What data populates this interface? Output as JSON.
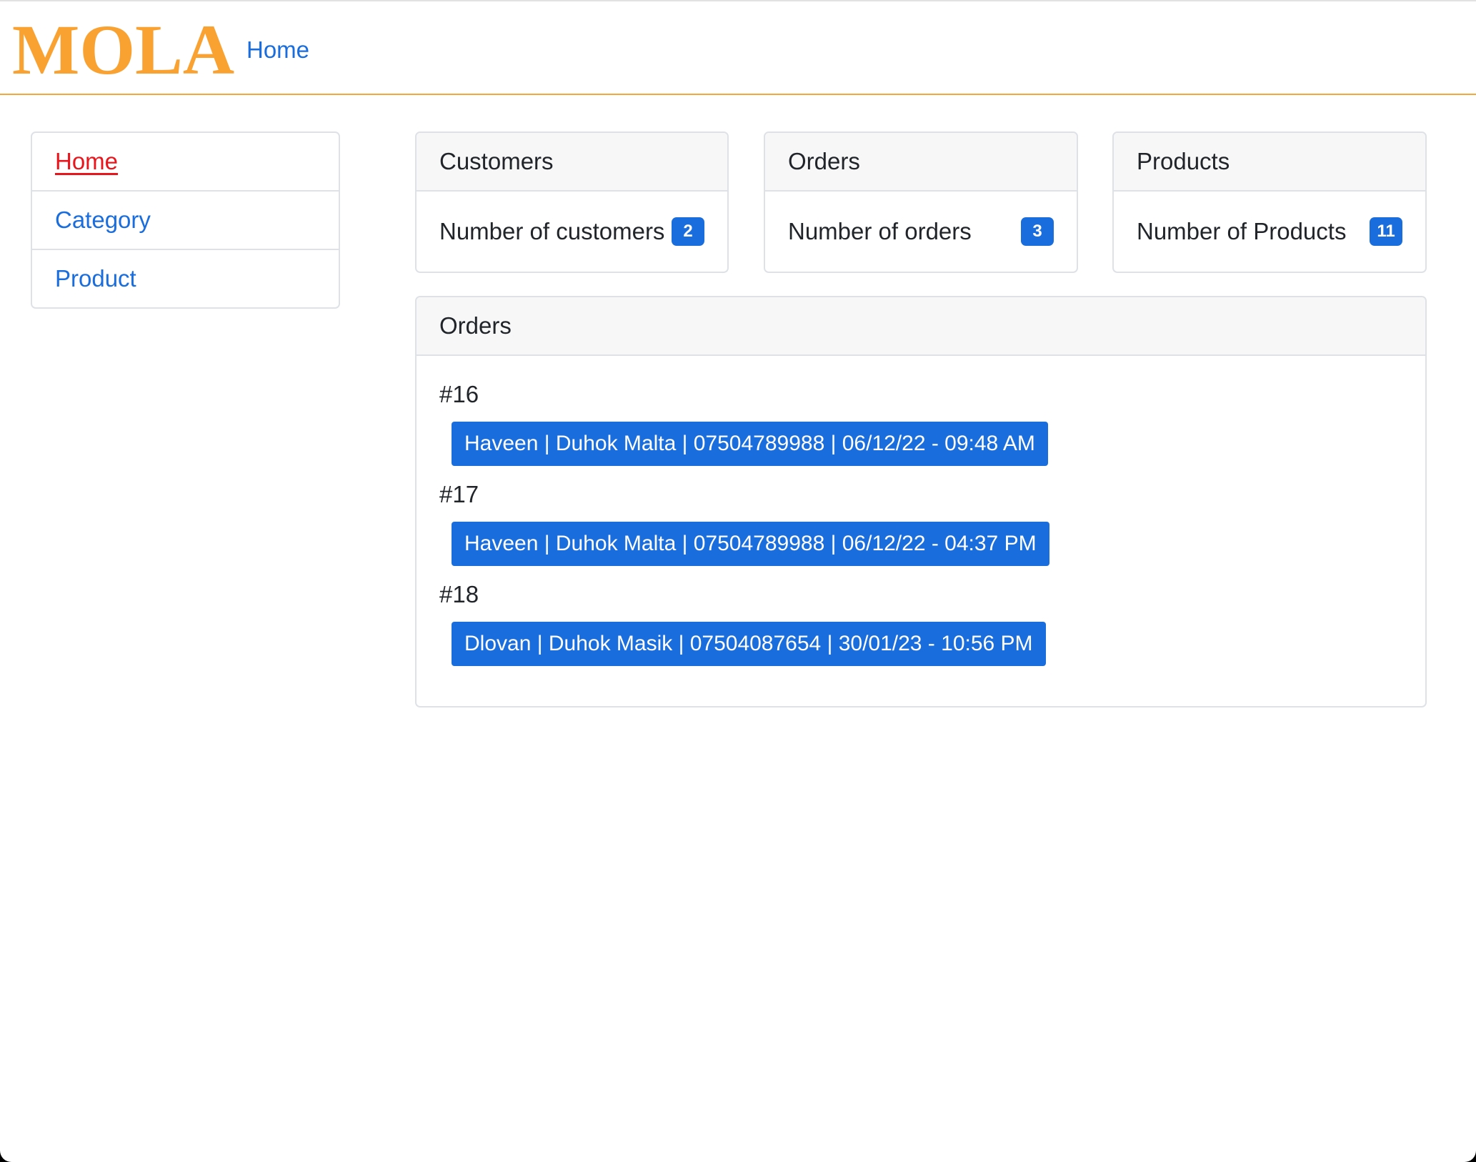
{
  "navbar": {
    "brand": "MOLA",
    "home_link": "Home"
  },
  "sidebar": {
    "items": [
      {
        "label": "Home",
        "active": true
      },
      {
        "label": "Category",
        "active": false
      },
      {
        "label": "Product",
        "active": false
      }
    ]
  },
  "stats": {
    "customers": {
      "title": "Customers",
      "label": "Number of customers",
      "count": "2"
    },
    "orders": {
      "title": "Orders",
      "label": "Number of orders",
      "count": "3"
    },
    "products": {
      "title": "Products",
      "label": "Number of Products",
      "count": "11"
    }
  },
  "orders_list": {
    "title": "Orders",
    "items": [
      {
        "number": "#16",
        "details": "Haveen | Duhok Malta | 07504789988 | 06/12/22 - 09:48 AM"
      },
      {
        "number": "#17",
        "details": "Haveen | Duhok Malta | 07504789988 | 06/12/22 - 04:37 PM"
      },
      {
        "number": "#18",
        "details": "Dlovan | Duhok Masik | 07504087654 | 30/01/23 - 10:56 PM"
      }
    ]
  },
  "colors": {
    "brand": "#f9a232",
    "link": "#1a6ddd",
    "active_link": "#e8161c",
    "badge": "#1a6ddd"
  }
}
